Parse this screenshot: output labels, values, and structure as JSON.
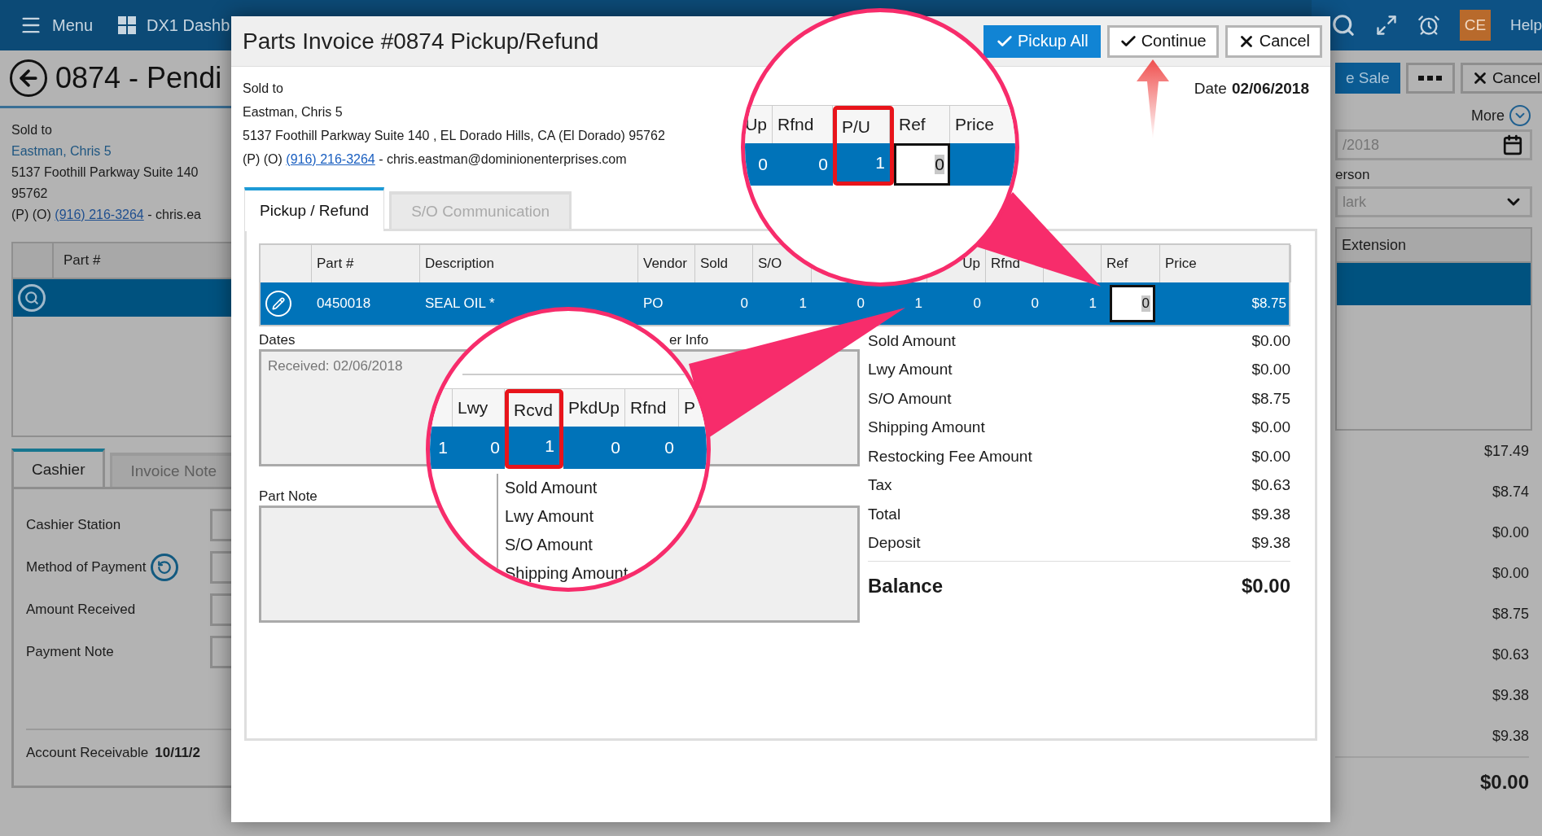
{
  "app_bar": {
    "menu": "Menu",
    "dashboard": "DX1 Dashb",
    "avatar": "CE",
    "help": "Help"
  },
  "page": {
    "title": "0874 - Pendi",
    "sold_to": {
      "label": "Sold to",
      "name": "Eastman, Chris 5",
      "address": "5137 Foothill Parkway Suite 140",
      "zip": "95762",
      "contact_prefix": "(P) (O)",
      "phone": "(916) 216-3264",
      "contact_rest": "- chris.ea"
    },
    "table": {
      "column": "Part #"
    },
    "tabs": [
      {
        "label": "Cashier",
        "selected": true
      },
      {
        "label": "Invoice Note",
        "selected": false
      }
    ],
    "fields": [
      {
        "label": "Cashier Station",
        "kind": "plain"
      },
      {
        "label": "Method of Payment",
        "kind": "refresh"
      },
      {
        "label": "Amount Received",
        "kind": "plain"
      },
      {
        "label": "Payment Note",
        "kind": "plain"
      }
    ],
    "account_receivable": {
      "label": "Account Receivable",
      "value": "10/11/2"
    }
  },
  "side": {
    "buttons": [
      {
        "kind": "primary",
        "label": "e Sale"
      },
      {
        "kind": "more"
      },
      {
        "kind": "cancel",
        "label": "Cancel"
      }
    ],
    "more": "More",
    "date": "/2018",
    "person_label": "erson",
    "person": "lark",
    "table": {
      "column": "Extension"
    },
    "totals": [
      "$17.49",
      "$8.74",
      "$0.00",
      "$0.00",
      "$8.75",
      "$0.63",
      "$9.38",
      "$9.38"
    ],
    "balance": "$0.00"
  },
  "dialog": {
    "title": "Parts Invoice #0874 Pickup/Refund",
    "buttons": [
      {
        "kind": "primary",
        "label": "Pickup All"
      },
      {
        "kind": "confirm",
        "label": "Continue"
      },
      {
        "kind": "cancel",
        "label": "Cancel"
      }
    ],
    "sold_to": {
      "label": "Sold to",
      "name": "Eastman, Chris 5",
      "address": "5137 Foothill Parkway Suite 140 , EL Dorado Hills, CA (El Dorado) 95762",
      "contact_prefix": "(P) (O)",
      "phone": "(916) 216-3264",
      "contact_rest": "- chris.eastman@dominionenterprises.com"
    },
    "date": {
      "label": "Date",
      "value": "02/06/2018"
    },
    "tabs": [
      {
        "label": "Pickup / Refund",
        "selected": true
      },
      {
        "label": "S/O Communication",
        "selected": false
      }
    ],
    "columns": [
      {
        "kind": "text",
        "label": "Part #"
      },
      {
        "kind": "text",
        "label": "Description"
      },
      {
        "kind": "text",
        "label": "Vendor"
      },
      {
        "kind": "number",
        "label": "Sold"
      },
      {
        "kind": "number",
        "label": "S/O"
      },
      {
        "kind": "number"
      },
      {
        "kind": "number"
      },
      {
        "kind": "number",
        "label": "Up"
      },
      {
        "kind": "number",
        "label": "Rfnd"
      },
      {
        "kind": "number"
      },
      {
        "kind": "input",
        "label": "Ref"
      },
      {
        "kind": "number",
        "label": "Price"
      }
    ],
    "rows": [
      {
        "selected": true,
        "cells": [
          "0450018",
          "SEAL OIL *",
          "PO",
          "0",
          "1",
          "0",
          "1",
          "0",
          "0",
          "1",
          "0",
          "$8.75"
        ]
      }
    ],
    "dates": {
      "label": "Dates",
      "received": "Received: 02/06/2018"
    },
    "vendor_info": {
      "label": "er Info"
    },
    "part_note": {
      "label": "Part Note"
    },
    "summary": [
      {
        "label": "Sold Amount",
        "value": "$0.00"
      },
      {
        "label": "Lwy Amount",
        "value": "$0.00"
      },
      {
        "label": "S/O Amount",
        "value": "$8.75"
      },
      {
        "label": "Shipping Amount",
        "value": "$0.00"
      },
      {
        "label": "Restocking Fee Amount",
        "value": "$0.00"
      },
      {
        "label": "Tax",
        "value": "$0.63"
      },
      {
        "label": "Total",
        "value": "$9.38"
      },
      {
        "label": "Deposit",
        "value": "$9.38"
      }
    ],
    "balance": {
      "label": "Balance",
      "value": "$0.00"
    }
  },
  "callouts": [
    {
      "columns": [
        {
          "kind": "number",
          "label": "Up",
          "value": "0",
          "highlighted": false
        },
        {
          "kind": "number",
          "label": "Rfnd",
          "value": "0",
          "highlighted": false
        },
        {
          "kind": "number",
          "label": "P/U",
          "value": "1",
          "highlighted": true
        },
        {
          "kind": "input",
          "label": "Ref",
          "value": "0",
          "highlighted": false
        },
        {
          "kind": "number",
          "label": "Price",
          "highlighted": false
        }
      ]
    },
    {
      "columns": [
        {
          "kind": "number",
          "value": "1",
          "highlighted": false
        },
        {
          "kind": "number",
          "label": "Lwy",
          "value": "0",
          "highlighted": false
        },
        {
          "kind": "number",
          "label": "Rcvd",
          "value": "1",
          "highlighted": true
        },
        {
          "kind": "number",
          "label": "PkdUp",
          "value": "0",
          "highlighted": false
        },
        {
          "kind": "number",
          "label": "Rfnd",
          "value": "0",
          "highlighted": false
        },
        {
          "kind": "number",
          "label": "P",
          "highlighted": false
        }
      ],
      "lines": [
        "Sold Amount",
        "Lwy Amount",
        "S/O Amount",
        "Shipping Amount"
      ]
    }
  ]
}
